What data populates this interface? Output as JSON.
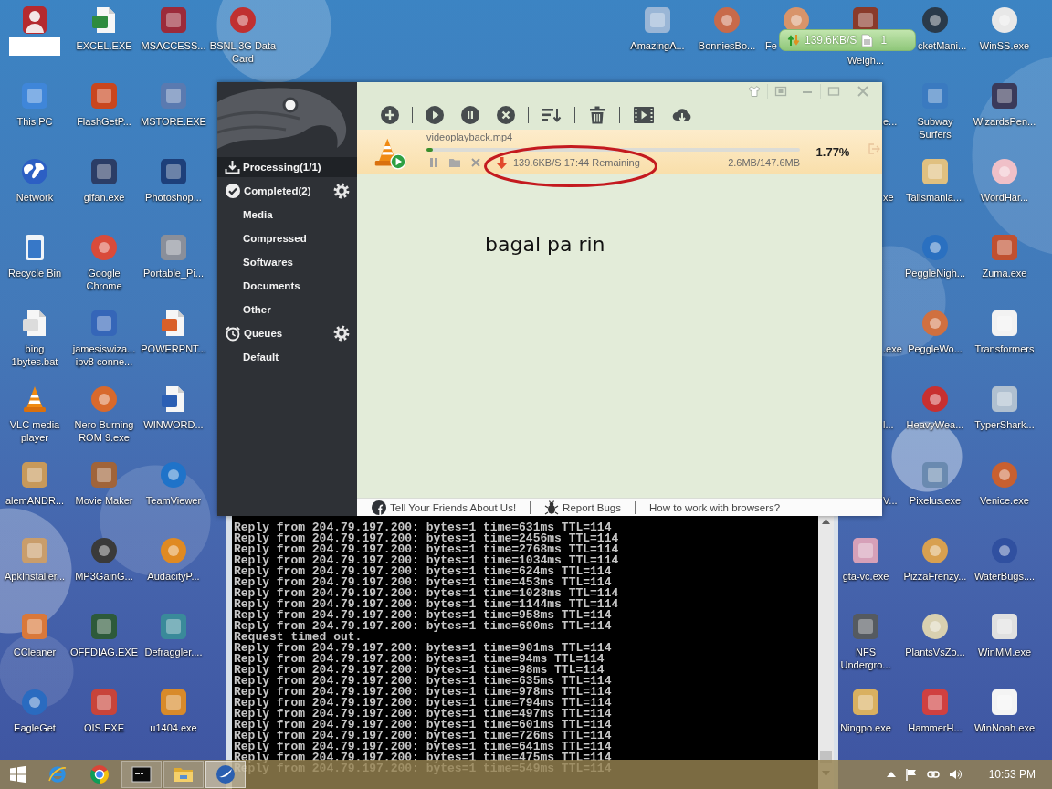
{
  "desktop": {
    "left_icons": [
      {
        "kind": "redacted"
      },
      {
        "kind": "icon",
        "label": "This PC"
      },
      {
        "kind": "icon",
        "label": "Network"
      },
      {
        "kind": "icon",
        "label": "Recycle Bin"
      },
      {
        "kind": "icon",
        "label": "bing\n1bytes.bat"
      },
      {
        "kind": "icon",
        "label": "VLC media\nplayer"
      },
      {
        "kind": "icon",
        "label": "alemANDR..."
      },
      {
        "kind": "icon",
        "label": "ApkInstaller..."
      },
      {
        "kind": "icon",
        "label": "CCleaner"
      },
      {
        "kind": "icon",
        "label": "EagleGet"
      },
      {
        "kind": "icon",
        "label": "EXCEL.EXE"
      },
      {
        "kind": "icon",
        "label": "FlashGetP..."
      },
      {
        "kind": "icon",
        "label": "gifan.exe"
      },
      {
        "kind": "icon",
        "label": "Google\nChrome"
      },
      {
        "kind": "icon",
        "label": "jamesiswiza...\nipv8 conne..."
      },
      {
        "kind": "icon",
        "label": "Nero Burning\nROM 9.exe"
      },
      {
        "kind": "icon",
        "label": "Movie Maker"
      },
      {
        "kind": "icon",
        "label": "MP3GainG..."
      },
      {
        "kind": "icon",
        "label": "OFFDIAG.EXE"
      },
      {
        "kind": "icon",
        "label": "OIS.EXE"
      },
      {
        "kind": "icon",
        "label": "MSACCESS..."
      },
      {
        "kind": "icon",
        "label": "MSTORE.EXE"
      },
      {
        "kind": "icon",
        "label": "Photoshop..."
      },
      {
        "kind": "icon",
        "label": "Portable_Pi..."
      },
      {
        "kind": "icon",
        "label": "POWERPNT..."
      },
      {
        "kind": "icon",
        "label": "WINWORD..."
      },
      {
        "kind": "icon",
        "label": "TeamViewer"
      },
      {
        "kind": "icon",
        "label": "AudacityP..."
      },
      {
        "kind": "icon",
        "label": "Defraggler...."
      },
      {
        "kind": "icon",
        "label": "u1404.exe"
      },
      {
        "kind": "icon",
        "label": "BSNL 3G Data\nCard"
      }
    ],
    "right_icons": [
      {
        "kind": "icon",
        "label": "AmazingA..."
      },
      {
        "kind": "icon",
        "label": "BonniesBo..."
      },
      {
        "kind": "label_head",
        "label": "Fe"
      },
      {
        "kind": "icon",
        "label": "Weigh..."
      },
      {
        "kind": "label_tail",
        "label": "e..."
      },
      {
        "kind": "label_tail",
        "label": "xe"
      },
      {
        "kind": "label_tail",
        "label": ".exe"
      },
      {
        "kind": "label_tail",
        "label": "l..."
      },
      {
        "kind": "label_tail",
        "label": "V..."
      },
      {
        "kind": "icon",
        "label": "gta-vc.exe"
      },
      {
        "kind": "icon",
        "label": "NFS\nUndergro..."
      },
      {
        "kind": "icon",
        "label": "Ningpo.exe"
      },
      {
        "kind": "icon",
        "label": "cketMani..."
      },
      {
        "kind": "icon",
        "label": "Subway\nSurfers"
      },
      {
        "kind": "icon",
        "label": "Talismania...."
      },
      {
        "kind": "icon",
        "label": "PeggleNigh..."
      },
      {
        "kind": "icon",
        "label": "PeggleWo..."
      },
      {
        "kind": "icon",
        "label": "HeavyWea..."
      },
      {
        "kind": "icon",
        "label": "Pixelus.exe"
      },
      {
        "kind": "icon",
        "label": "PizzaFrenzy..."
      },
      {
        "kind": "icon",
        "label": "PlantsVsZo..."
      },
      {
        "kind": "icon",
        "label": "HammerH..."
      },
      {
        "kind": "icon",
        "label": "WinSS.exe"
      },
      {
        "kind": "icon",
        "label": "WizardsPen..."
      },
      {
        "kind": "icon",
        "label": "WordHar..."
      },
      {
        "kind": "icon",
        "label": "Zuma.exe"
      },
      {
        "kind": "icon",
        "label": "Transformers"
      },
      {
        "kind": "icon",
        "label": "TyperShark..."
      },
      {
        "kind": "icon",
        "label": "Venice.exe"
      },
      {
        "kind": "icon",
        "label": "WaterBugs...."
      },
      {
        "kind": "icon",
        "label": "WinMM.exe"
      },
      {
        "kind": "icon",
        "label": "WinNoah.exe"
      }
    ]
  },
  "speed_widget": {
    "speed": "139.6KB/S",
    "count": "1"
  },
  "eagleget": {
    "sidebar": [
      {
        "label": "Processing(1/1)",
        "selected": true,
        "settings": false
      },
      {
        "label": "Completed(2)",
        "selected": false,
        "settings": true,
        "children": [
          {
            "label": "Media",
            "selected": false
          },
          {
            "label": "Compressed",
            "selected": false
          },
          {
            "label": "Softwares",
            "selected": false
          },
          {
            "label": "Documents",
            "selected": false
          },
          {
            "label": "Other",
            "selected": false
          }
        ]
      },
      {
        "label": "Queues",
        "selected": false,
        "settings": true,
        "children": [
          {
            "label": "Default",
            "selected": false
          }
        ]
      }
    ],
    "download": {
      "file_name": "videoplayback.mp4",
      "level": 0.0177,
      "percent": "1.77%",
      "status": "139.6KB/S 17:44 Remaining",
      "size": "2.6MB/147.6MB"
    },
    "note": "bagal pa rin",
    "footer_links": [
      "Tell Your Friends About Us!",
      "Report Bugs",
      "How to work with browsers?"
    ]
  },
  "console": {
    "lines": [
      "Reply from 204.79.197.200: bytes=1 time=631ms TTL=114",
      "Reply from 204.79.197.200: bytes=1 time=2456ms TTL=114",
      "Reply from 204.79.197.200: bytes=1 time=2768ms TTL=114",
      "Reply from 204.79.197.200: bytes=1 time=1034ms TTL=114",
      "Reply from 204.79.197.200: bytes=1 time=624ms TTL=114",
      "Reply from 204.79.197.200: bytes=1 time=453ms TTL=114",
      "Reply from 204.79.197.200: bytes=1 time=1028ms TTL=114",
      "Reply from 204.79.197.200: bytes=1 time=1144ms TTL=114",
      "Reply from 204.79.197.200: bytes=1 time=958ms TTL=114",
      "Reply from 204.79.197.200: bytes=1 time=690ms TTL=114",
      "Request timed out.",
      "Reply from 204.79.197.200: bytes=1 time=901ms TTL=114",
      "Reply from 204.79.197.200: bytes=1 time=94ms TTL=114",
      "Reply from 204.79.197.200: bytes=1 time=98ms TTL=114",
      "Reply from 204.79.197.200: bytes=1 time=635ms TTL=114",
      "Reply from 204.79.197.200: bytes=1 time=978ms TTL=114",
      "Reply from 204.79.197.200: bytes=1 time=794ms TTL=114",
      "Reply from 204.79.197.200: bytes=1 time=497ms TTL=114",
      "Reply from 204.79.197.200: bytes=1 time=601ms TTL=114",
      "Reply from 204.79.197.200: bytes=1 time=726ms TTL=114",
      "Reply from 204.79.197.200: bytes=1 time=641ms TTL=114",
      "Reply from 204.79.197.200: bytes=1 time=475ms TTL=114",
      "Reply from 204.79.197.200: bytes=1 time=549ms TTL=114"
    ]
  },
  "taskbar": {
    "apps": [
      {
        "running": false,
        "selected": false
      },
      {
        "running": false,
        "selected": false
      },
      {
        "running": true,
        "selected": false
      },
      {
        "running": true,
        "selected": false
      },
      {
        "running": true,
        "selected": true
      }
    ],
    "clock": "10:53 PM"
  }
}
